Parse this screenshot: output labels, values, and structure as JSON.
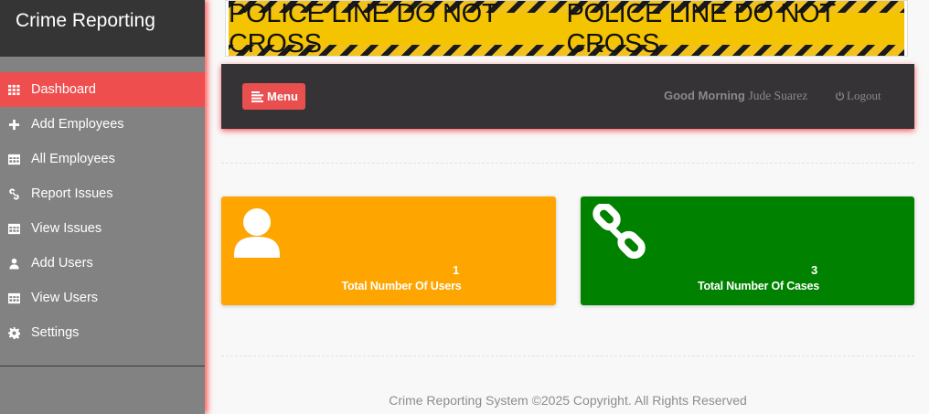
{
  "sidebar": {
    "brand": "Crime Reporting",
    "items": [
      {
        "label": "Dashboard",
        "icon": "grid-icon",
        "active": true
      },
      {
        "label": "Add Employees",
        "icon": "plus-icon"
      },
      {
        "label": "All Employees",
        "icon": "table-icon"
      },
      {
        "label": "Report Issues",
        "icon": "link-icon"
      },
      {
        "label": "View Issues",
        "icon": "table-icon"
      },
      {
        "label": "Add Users",
        "icon": "user-icon"
      },
      {
        "label": "View Users",
        "icon": "table-icon"
      },
      {
        "label": "Settings",
        "icon": "gear-icon"
      }
    ]
  },
  "banner": {
    "text": "POLICE LINE DO NOT CROSS",
    "colors": {
      "yellow": "#f5c400",
      "black": "#1a1a1a"
    }
  },
  "topbar": {
    "menu_label": "Menu",
    "greeting": "Good Morning",
    "user_name": "Jude Suarez",
    "logout_label": "Logout"
  },
  "cards": {
    "users": {
      "count": "1",
      "label": "Total Number Of Users",
      "color": "#fea500",
      "icon": "user-icon"
    },
    "cases": {
      "count": "3",
      "label": "Total Number Of Cases",
      "color": "#008100",
      "icon": "chain-link-icon"
    }
  },
  "footer": {
    "text": "Crime Reporting System ©2025 Copyright. All Rights Reserved"
  },
  "colors": {
    "accent": "#ef4e4e",
    "sidebar": "#828282",
    "dark": "#353335"
  }
}
